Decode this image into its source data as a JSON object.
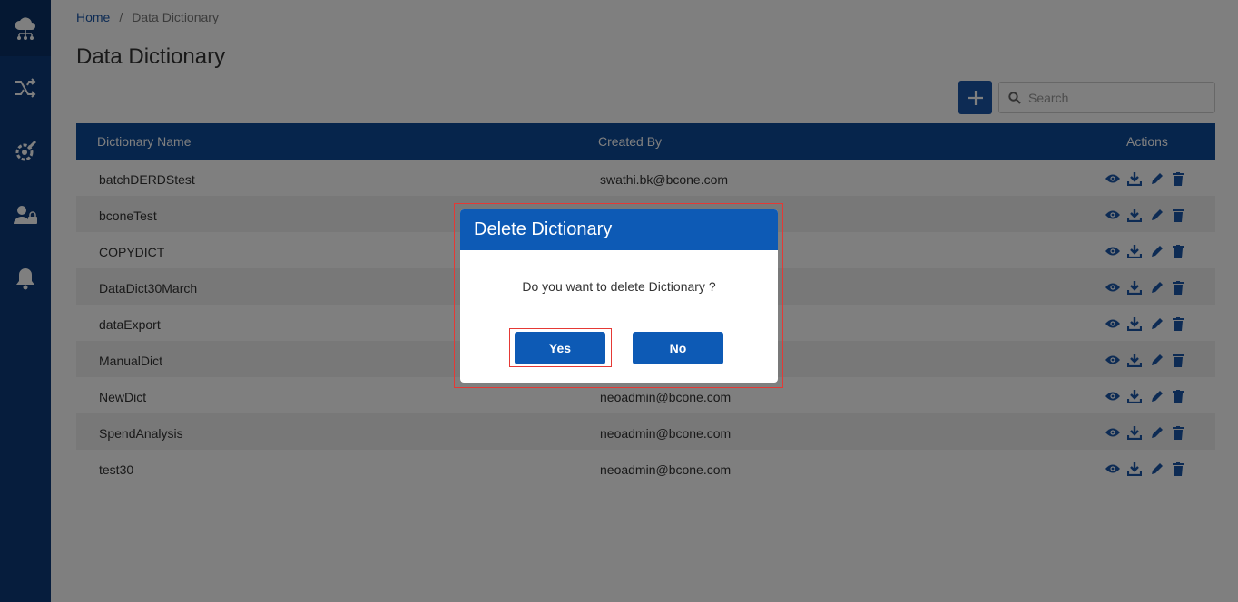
{
  "breadcrumb": {
    "home": "Home",
    "separator": "/",
    "current": "Data Dictionary"
  },
  "page_title": "Data Dictionary",
  "search": {
    "placeholder": "Search",
    "value": ""
  },
  "table": {
    "headers": {
      "name": "Dictionary Name",
      "created_by": "Created By",
      "actions": "Actions"
    },
    "rows": [
      {
        "name": "batchDERDStest",
        "created_by": "swathi.bk@bcone.com"
      },
      {
        "name": "bconeTest",
        "created_by": ""
      },
      {
        "name": "COPYDICT",
        "created_by": ""
      },
      {
        "name": "DataDict30March",
        "created_by": ""
      },
      {
        "name": "dataExport",
        "created_by": ""
      },
      {
        "name": "ManualDict",
        "created_by": ""
      },
      {
        "name": "NewDict",
        "created_by": "neoadmin@bcone.com"
      },
      {
        "name": "SpendAnalysis",
        "created_by": "neoadmin@bcone.com"
      },
      {
        "name": "test30",
        "created_by": "neoadmin@bcone.com"
      }
    ],
    "row_actions": [
      "eye-icon",
      "download-icon",
      "pencil-icon",
      "trash-icon"
    ]
  },
  "sidebar": {
    "items": [
      {
        "icon": "cloud-network-icon"
      },
      {
        "icon": "shuffle-icon"
      },
      {
        "icon": "gear-wrench-icon"
      },
      {
        "icon": "user-lock-icon"
      },
      {
        "icon": "bell-icon"
      }
    ]
  },
  "modal": {
    "title": "Delete Dictionary",
    "message": "Do you want to delete Dictionary ?",
    "yes_label": "Yes",
    "no_label": "No"
  },
  "colors": {
    "sidebar": "#0d3b7a",
    "header": "#0d4a98",
    "primary": "#0d5ab5",
    "highlight": "#e53935"
  }
}
